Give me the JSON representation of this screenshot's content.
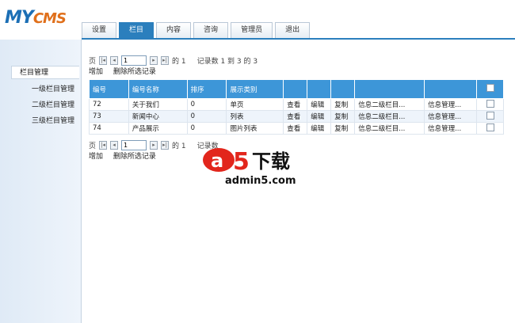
{
  "logo": {
    "my": "MY",
    "cms": "CMS"
  },
  "tabs": [
    {
      "label": "设置",
      "active": false
    },
    {
      "label": "栏目",
      "active": true
    },
    {
      "label": "内容",
      "active": false
    },
    {
      "label": "咨询",
      "active": false
    },
    {
      "label": "管理员",
      "active": false
    },
    {
      "label": "退出",
      "active": false
    }
  ],
  "sidebar": {
    "header": "栏目管理",
    "items": [
      "一级栏目管理",
      "二级栏目管理",
      "三级栏目管理"
    ]
  },
  "pager": {
    "prefix": "页",
    "current": "1",
    "of_text": "的 1",
    "records_text": "记录数 1 到 3 的 3",
    "records_text_partial": "记录数"
  },
  "actions": {
    "add": "增加",
    "delete_selected": "删除所选记录"
  },
  "table": {
    "headers": [
      "编号",
      "编号名称",
      "排序",
      "展示类别",
      "",
      "",
      "",
      "",
      ""
    ],
    "rows": [
      {
        "id": "72",
        "name": "关于我们",
        "order": "0",
        "type": "单页",
        "view": "查看",
        "edit": "编辑",
        "copy": "复制",
        "col2": "信息二级栏目...",
        "col3": "信息管理..."
      },
      {
        "id": "73",
        "name": "新闻中心",
        "order": "0",
        "type": "列表",
        "view": "查看",
        "edit": "编辑",
        "copy": "复制",
        "col2": "信息二级栏目...",
        "col3": "信息管理..."
      },
      {
        "id": "74",
        "name": "产品展示",
        "order": "0",
        "type": "图片列表",
        "view": "查看",
        "edit": "编辑",
        "copy": "复制",
        "col2": "信息二级栏目...",
        "col3": "信息管理..."
      }
    ]
  },
  "watermark": {
    "brand_a": "a",
    "brand_5": "5",
    "brand_cn": "下载",
    "url": "admin5.com"
  },
  "colors": {
    "accent": "#2b7fbd",
    "header_blue": "#3d96d8",
    "logo_blue": "#1c6fb5",
    "logo_orange": "#e0701c",
    "watermark_red": "#e2261c"
  }
}
